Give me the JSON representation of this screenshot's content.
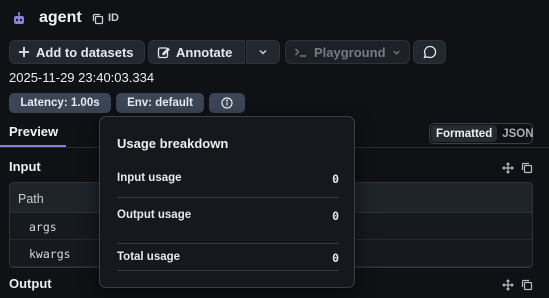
{
  "header": {
    "title": "agent",
    "id_label": "ID"
  },
  "toolbar": {
    "add_label": "Add to datasets",
    "annotate_label": "Annotate",
    "playground_label": "Playground"
  },
  "run": {
    "timestamp": "2025-11-29 23:40:03.334",
    "tags": {
      "latency": "Latency: 1.00s",
      "env": "Env: default"
    }
  },
  "tabs": {
    "preview": "Preview",
    "formatted": "Formatted",
    "json": "JSON"
  },
  "input": {
    "label": "Input",
    "table": {
      "header": "Path",
      "rows": [
        "args",
        "kwargs"
      ]
    }
  },
  "output": {
    "label": "Output"
  },
  "usage_popover": {
    "title": "Usage breakdown",
    "rows": [
      {
        "label": "Input usage",
        "value": "0"
      },
      {
        "label": "Output usage",
        "value": "0"
      },
      {
        "label": "Total usage",
        "value": "0"
      }
    ]
  },
  "colors": {
    "background": "#0f1114",
    "tag_bg": "#3b4556",
    "accent": "#8b7fdc",
    "robot": "#8e7fd8"
  },
  "icons": [
    "robot-icon",
    "copy-icon",
    "plus-icon",
    "edit-icon",
    "chevron-down-icon",
    "terminal-icon",
    "chat-icon",
    "info-icon",
    "move-icon"
  ]
}
